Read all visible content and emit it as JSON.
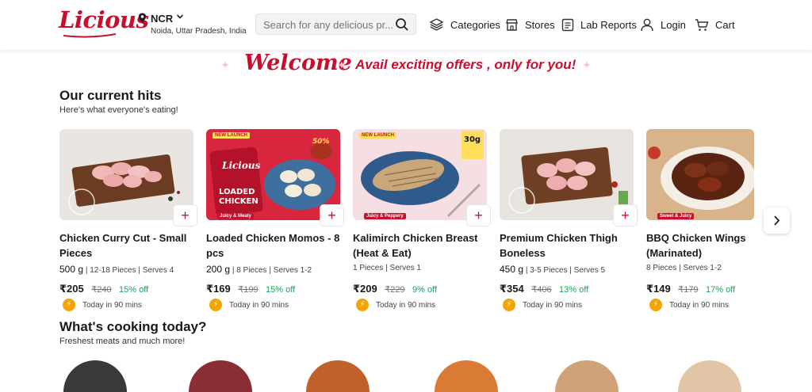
{
  "header": {
    "brand": "Licious",
    "location": {
      "city": "NCR",
      "address": "Noida, Uttar Pradesh, India"
    },
    "search": {
      "placeholder": "Search for any delicious pr..."
    },
    "nav": [
      {
        "label": "Categories",
        "icon": "layers-icon"
      },
      {
        "label": "Stores",
        "icon": "store-icon"
      },
      {
        "label": "Lab Reports",
        "icon": "report-icon"
      },
      {
        "label": "Login",
        "icon": "user-icon"
      },
      {
        "label": "Cart",
        "icon": "cart-icon"
      }
    ]
  },
  "banner": {
    "welcome": "Welcome",
    "offer": "Avail exciting offers , only for you!"
  },
  "hits": {
    "title": "Our current hits",
    "subtitle": "Here's what everyone's eating!",
    "products": [
      {
        "name": "Chicken Curry Cut - Small Pieces",
        "weight": "500 g",
        "pieces": "12-18 Pieces",
        "serves": "Serves 4",
        "price": "₹205",
        "mrp": "₹240",
        "discount": "15% off",
        "delivery": "Today in 90 mins"
      },
      {
        "name": "Loaded Chicken Momos - 8 pcs",
        "weight": "200 g",
        "pieces": "8 Pieces",
        "serves": "Serves 1-2",
        "price": "₹169",
        "mrp": "₹199",
        "discount": "15% off",
        "delivery": "Today in 90 mins",
        "badge": "NEW LAUNCH",
        "tag": "Juicy & Meaty",
        "promo": "50% MORE PROTEIN"
      },
      {
        "name": "Kalimirch Chicken Breast (Heat & Eat)",
        "weight": "",
        "pieces": "1 Pieces",
        "serves": "Serves 1",
        "price": "₹209",
        "mrp": "₹229",
        "discount": "9% off",
        "delivery": "Today in 90 mins",
        "badge": "NEW LAUNCH",
        "tag": "Juicy & Peppery",
        "promo": "30g PROTEIN"
      },
      {
        "name": "Premium Chicken Thigh Boneless",
        "weight": "450 g",
        "pieces": "3-5 Pieces",
        "serves": "Serves 5",
        "price": "₹354",
        "mrp": "₹406",
        "discount": "13% off",
        "delivery": "Today in 90 mins"
      },
      {
        "name": "BBQ Chicken Wings (Marinated)",
        "weight": "",
        "pieces": "8 Pieces",
        "serves": "Serves 1-2",
        "price": "₹149",
        "mrp": "₹179",
        "discount": "17% off",
        "delivery": "Today in 90 mins",
        "tag": "Sweet & Juicy"
      }
    ]
  },
  "cooking": {
    "title": "What's cooking today?",
    "subtitle": "Freshest meats and much more!"
  },
  "colors": {
    "brand": "#c8102e",
    "discount": "#1aa45c",
    "bolt": "#f4a300"
  }
}
